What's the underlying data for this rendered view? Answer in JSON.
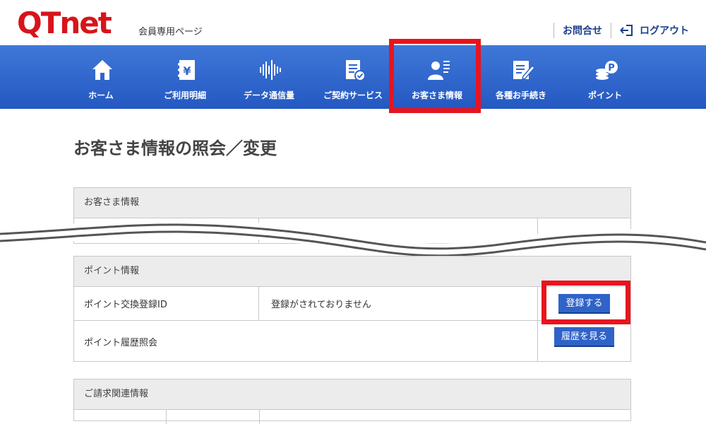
{
  "header": {
    "logo": "QTnet",
    "subtitle": "会員専用ページ",
    "contact": "お問合せ",
    "logout": "ログアウト"
  },
  "nav": [
    {
      "label": "ホーム",
      "icon": "home-icon"
    },
    {
      "label": "ご利用明細",
      "icon": "yen-book-icon"
    },
    {
      "label": "データ通信量",
      "icon": "sound-wave-icon"
    },
    {
      "label": "ご契約サービス",
      "icon": "contract-check-icon"
    },
    {
      "label": "お客さま情報",
      "icon": "user-info-icon"
    },
    {
      "label": "各種お手続き",
      "icon": "edit-document-icon"
    },
    {
      "label": "ポイント",
      "icon": "coins-point-icon"
    }
  ],
  "page_title": "お客さま情報の照会／変更",
  "customer_section": {
    "header": "お客さま情報"
  },
  "points_section": {
    "header": "ポイント情報",
    "rows": [
      {
        "label": "ポイント交換登録ID",
        "value": "登録がされておりません",
        "button": "登録する"
      },
      {
        "label": "ポイント履歴照会",
        "value": "",
        "button": "履歴を見る"
      }
    ]
  },
  "billing_section": {
    "header": "ご請求関連情報"
  },
  "colors": {
    "nav": "#2f66cc",
    "highlight": "#e8141e",
    "button": "#2f63c8",
    "logo_red": "#d7141a"
  }
}
